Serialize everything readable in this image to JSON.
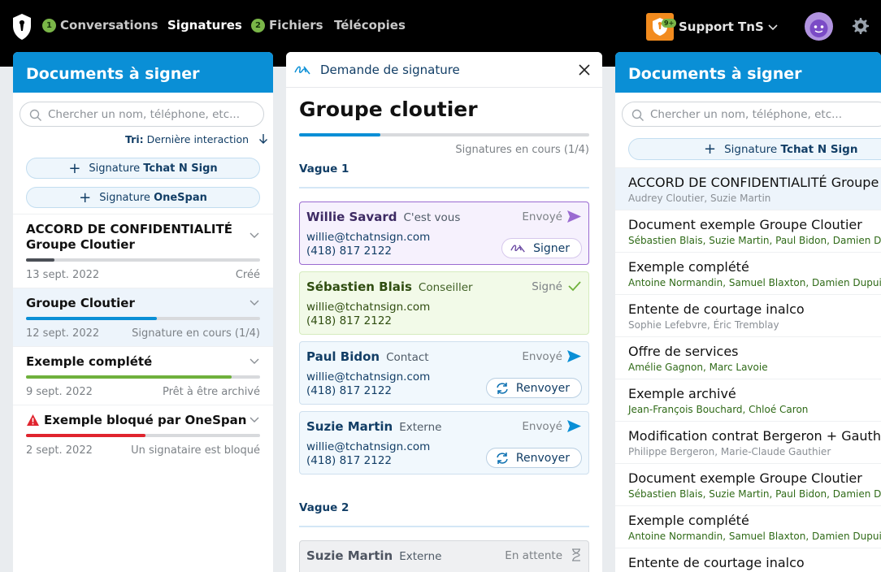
{
  "nav": {
    "conversations": {
      "label": "Conversations",
      "badge": "1"
    },
    "signatures": {
      "label": "Signatures"
    },
    "fichiers": {
      "label": "Fichiers",
      "badge": "2"
    },
    "telecopies": {
      "label": "Télécopies"
    },
    "support": {
      "label": "Support TnS",
      "badge": "9+"
    }
  },
  "left": {
    "title": "Documents à signer",
    "search_placeholder": "Chercher un nom, téléphone, etc...",
    "sort_label": "Tri:",
    "sort_value": "Dernière interaction",
    "btn1_prefix": "Signature",
    "btn1_name": "Tchat N Sign",
    "btn2_prefix": "Signature",
    "btn2_name": "OneSpan",
    "docs": [
      {
        "title": "ACCORD DE CONFIDENTIALITÉ Groupe Cloutier",
        "date": "13 sept. 2022",
        "status": "Créé",
        "progress": 0.12,
        "color": "#4b4f56"
      },
      {
        "title": "Groupe Cloutier",
        "date": "12 sept. 2022",
        "status": "Signature en cours (1/4)",
        "progress": 0.56,
        "color": "#0a8fd6"
      },
      {
        "title": "Exemple complété",
        "date": "9 sept. 2022",
        "status": "Prêt à être archivé",
        "progress": 0.88,
        "color": "#6fb13c"
      },
      {
        "title": "Exemple bloqué par OneSpan",
        "date": "2 sept. 2022",
        "status": "Un signataire est bloqué",
        "progress": 0.51,
        "color": "#e0242e"
      }
    ]
  },
  "middle": {
    "header": "Demande de signature",
    "title": "Groupe cloutier",
    "progress_text": "Signatures en cours (1/4)",
    "progress": 0.28,
    "wave1": "Vague 1",
    "wave2": "Vague 2",
    "signers": [
      {
        "name": "Willie Savard",
        "role": "C'est vous",
        "status": "Envoyé",
        "email": "willie@tchatnsign.com",
        "phone": "(418) 817 2122",
        "action": "Signer"
      },
      {
        "name": "Sébastien Blais",
        "role": "Conseiller",
        "status": "Signé",
        "email": "willie@tchatnsign.com",
        "phone": "(418) 817 2122"
      },
      {
        "name": "Paul Bidon",
        "role": "Contact",
        "status": "Envoyé",
        "email": "willie@tchatnsign.com",
        "phone": "(418) 817 2122",
        "action": "Renvoyer"
      },
      {
        "name": "Suzie Martin",
        "role": "Externe",
        "status": "Envoyé",
        "email": "willie@tchatnsign.com",
        "phone": "(418) 817 2122",
        "action": "Renvoyer"
      },
      {
        "name": "Suzie Martin",
        "role": "Externe",
        "status": "En attente"
      }
    ]
  },
  "right": {
    "title": "Documents à signer",
    "search_placeholder": "Chercher un nom, téléphone, etc...",
    "btn_prefix": "Signature",
    "btn_name": "Tchat N Sign",
    "items": [
      {
        "title": "ACCORD DE CONFIDENTIALITÉ Groupe Cloutier",
        "people": "Audrey Cloutier, Suzie Martin",
        "green": false
      },
      {
        "title": "Document exemple Groupe Cloutier",
        "people": "Sébastien Blais, Suzie Martin, Paul Bidon, Damien Dupuis",
        "green": true
      },
      {
        "title": "Exemple complété",
        "people": "Antoine Normandin, Samuel Blaxton, Damien Dupuis",
        "green": true
      },
      {
        "title": "Entente de courtage inalco",
        "people": "Sophie Lefebvre, Éric Tremblay",
        "green": false
      },
      {
        "title": "Offre de services",
        "people": "Amélie Gagnon, Marc Lavoie",
        "green": true
      },
      {
        "title": "Exemple archivé",
        "people": "Jean-François Bouchard, Chloé Caron",
        "green": true
      },
      {
        "title": "Modification contrat Bergeron + Gauthier",
        "people": "Philippe Bergeron, Marie-Claude Gauthier",
        "green": false
      },
      {
        "title": "Document exemple Groupe Cloutier",
        "people": "Sébastien Blais, Suzie Martin, Paul Bidon, Damien Dupuis",
        "green": true
      },
      {
        "title": "Exemple complété",
        "people": "Antoine Normandin, Samuel Blaxton, Damien Dupuis",
        "green": true
      },
      {
        "title": "Entente de courtage inalco",
        "people": "",
        "green": false
      }
    ]
  },
  "icons": [
    "app-logo-icon",
    "shield-icon",
    "chevron-down-icon",
    "avatar",
    "gear-icon",
    "search-icon",
    "arrow-down-icon",
    "plus-icon",
    "signature-icon",
    "close-icon",
    "send-icon",
    "check-icon",
    "refresh-icon",
    "hourglass-icon",
    "warning-icon"
  ]
}
